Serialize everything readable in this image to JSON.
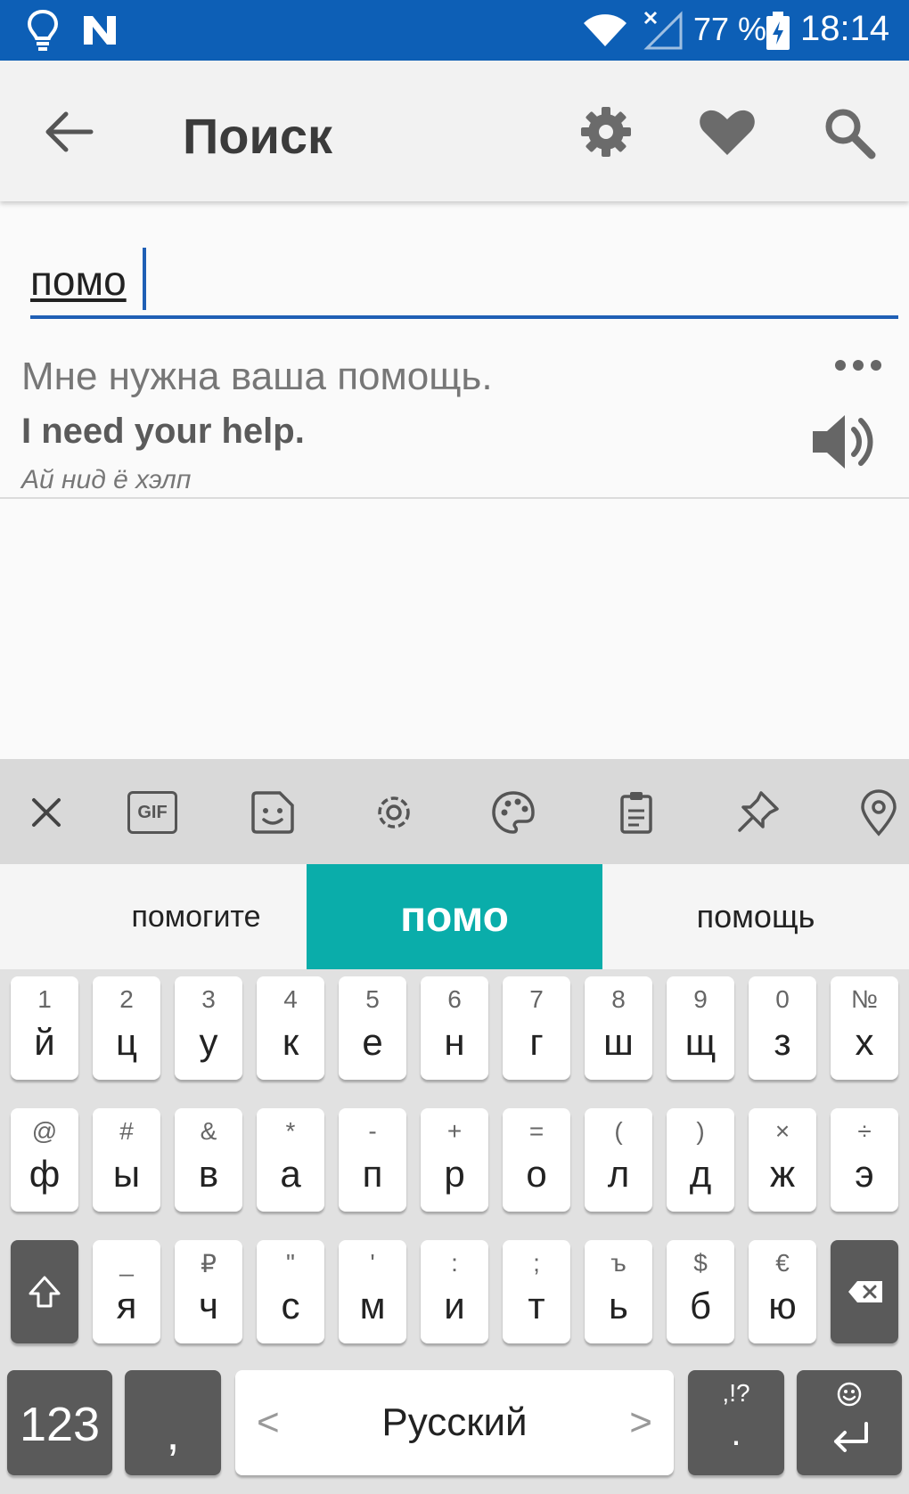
{
  "status_bar": {
    "battery": "77 %",
    "time": "18:14"
  },
  "app_bar": {
    "title": "Поиск"
  },
  "search": {
    "value": "помо"
  },
  "result": {
    "russian": "Мне нужна ваша помощь.",
    "english": "I need your help.",
    "transcription": "Ай нид ё хэлп"
  },
  "keyboard": {
    "toolbar_icons": [
      "close-icon",
      "gif-icon",
      "sticker-icon",
      "settings-icon",
      "palette-icon",
      "clipboard-icon",
      "pin-icon",
      "location-icon"
    ],
    "gif_label": "GIF",
    "suggestions": [
      "помогите",
      "помо",
      "помощь"
    ],
    "row1": [
      {
        "hint": "1",
        "key": "й"
      },
      {
        "hint": "2",
        "key": "ц"
      },
      {
        "hint": "3",
        "key": "у"
      },
      {
        "hint": "4",
        "key": "к"
      },
      {
        "hint": "5",
        "key": "е"
      },
      {
        "hint": "6",
        "key": "н"
      },
      {
        "hint": "7",
        "key": "г"
      },
      {
        "hint": "8",
        "key": "ш"
      },
      {
        "hint": "9",
        "key": "щ"
      },
      {
        "hint": "0",
        "key": "з"
      },
      {
        "hint": "№",
        "key": "х"
      }
    ],
    "row2": [
      {
        "hint": "@",
        "key": "ф"
      },
      {
        "hint": "#",
        "key": "ы"
      },
      {
        "hint": "&",
        "key": "в"
      },
      {
        "hint": "*",
        "key": "а"
      },
      {
        "hint": "-",
        "key": "п"
      },
      {
        "hint": "+",
        "key": "р"
      },
      {
        "hint": "=",
        "key": "о"
      },
      {
        "hint": "(",
        "key": "л"
      },
      {
        "hint": ")",
        "key": "д"
      },
      {
        "hint": "×",
        "key": "ж"
      },
      {
        "hint": "÷",
        "key": "э"
      }
    ],
    "row3": [
      {
        "hint": "_",
        "key": "я"
      },
      {
        "hint": "₽",
        "key": "ч"
      },
      {
        "hint": "\"",
        "key": "с"
      },
      {
        "hint": "'",
        "key": "м"
      },
      {
        "hint": ":",
        "key": "и"
      },
      {
        "hint": ";",
        "key": "т"
      },
      {
        "hint": "ъ",
        "key": "ь"
      },
      {
        "hint": "$",
        "key": "б"
      },
      {
        "hint": "€",
        "key": "ю"
      }
    ],
    "numbers_key": "123",
    "comma_key": ",",
    "space_label": "Русский",
    "space_left": "<",
    "space_right": ">",
    "punct_hint": ",!?",
    "punct_key": "."
  }
}
